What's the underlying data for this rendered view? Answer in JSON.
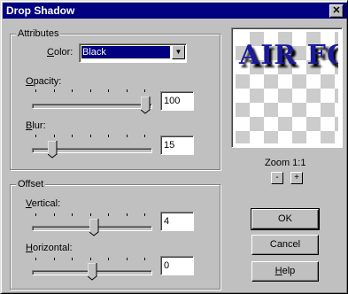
{
  "window": {
    "title": "Drop Shadow",
    "close_glyph": "✕"
  },
  "attributes": {
    "group_label": "Attributes",
    "color_label": "Color:",
    "color_value": "Black",
    "opacity_label": "Opacity:",
    "opacity_value": "100",
    "opacity_level": 1.0,
    "blur_label": "Blur:",
    "blur_value": "15",
    "blur_level": 0.15
  },
  "offset": {
    "group_label": "Offset",
    "vertical_label": "Vertical:",
    "vertical_value": "4",
    "horizontal_label": "Horizontal:",
    "horizontal_value": "0"
  },
  "preview": {
    "text": "AIR FO"
  },
  "zoom": {
    "label": "Zoom 1:1",
    "minus": "-",
    "plus": "+"
  },
  "buttons": {
    "ok": "OK",
    "cancel": "Cancel",
    "help": "Help"
  },
  "colors": {
    "title_bar": "#000080",
    "face": "#c0c0c0",
    "preview_text": "#1a1a9a"
  }
}
